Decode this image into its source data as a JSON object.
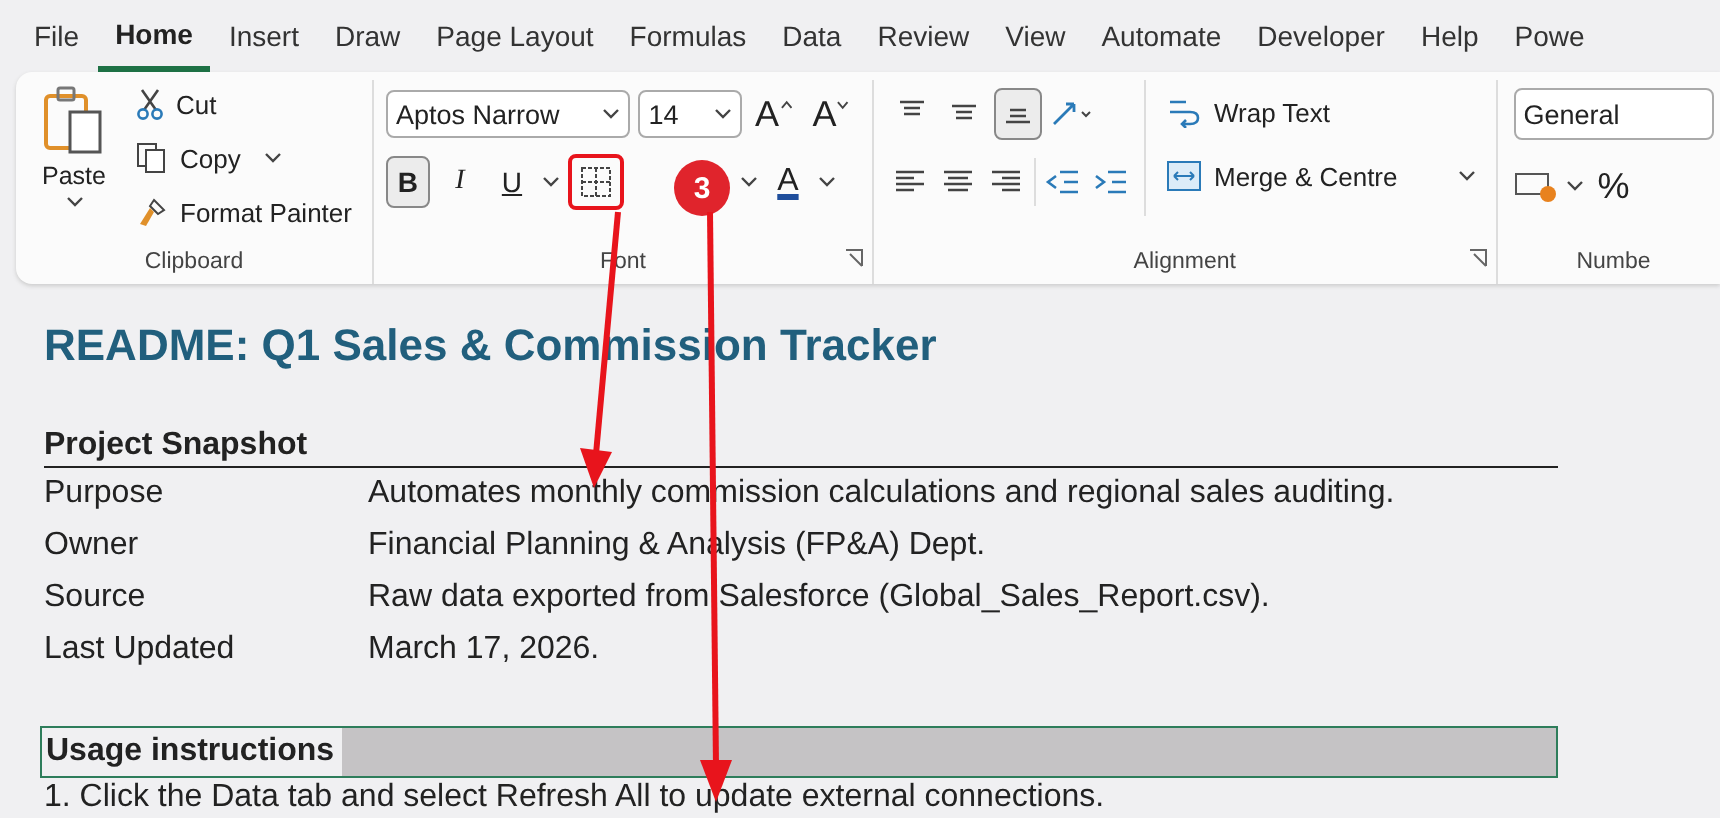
{
  "menu_tabs": [
    {
      "label": "File",
      "selected": false
    },
    {
      "label": "Home",
      "selected": true
    },
    {
      "label": "Insert",
      "selected": false
    },
    {
      "label": "Draw",
      "selected": false
    },
    {
      "label": "Page Layout",
      "selected": false
    },
    {
      "label": "Formulas",
      "selected": false
    },
    {
      "label": "Data",
      "selected": false
    },
    {
      "label": "Review",
      "selected": false
    },
    {
      "label": "View",
      "selected": false
    },
    {
      "label": "Automate",
      "selected": false
    },
    {
      "label": "Developer",
      "selected": false
    },
    {
      "label": "Help",
      "selected": false
    },
    {
      "label": "Powe",
      "selected": false
    }
  ],
  "clipboard": {
    "paste": "Paste",
    "cut": "Cut",
    "copy": "Copy",
    "format_painter": "Format Painter",
    "label": "Clipboard"
  },
  "font": {
    "family": "Aptos Narrow",
    "size": "14",
    "grow": "A",
    "shrink": "A",
    "styles": [
      {
        "label": "B",
        "kind": "bold",
        "selected": true
      },
      {
        "label": "I",
        "kind": "italic",
        "selected": false
      },
      {
        "label": "U",
        "kind": "underline",
        "selected": false
      }
    ],
    "font_color": "A",
    "label": "Font"
  },
  "annotation": {
    "badge": "3"
  },
  "alignment": {
    "vertical": [
      {
        "kind": "top",
        "selected": false
      },
      {
        "kind": "middle",
        "selected": false
      },
      {
        "kind": "bottom",
        "selected": true
      }
    ],
    "wrap_text": "Wrap Text",
    "merge": "Merge & Centre",
    "label": "Alignment"
  },
  "number": {
    "format": "General",
    "percent": "%",
    "label": "Numbe"
  },
  "sheet": {
    "title": "README: Q1 Sales & Commission Tracker",
    "snapshot_heading": "Project Snapshot",
    "rows": [
      {
        "label": "Purpose",
        "value": "Automates monthly commission calculations and regional sales auditing."
      },
      {
        "label": "Owner",
        "value": "Financial Planning & Analysis (FP&A) Dept."
      },
      {
        "label": "Source",
        "value": "Raw data exported from Salesforce (Global_Sales_Report.csv)."
      },
      {
        "label": "Last Updated",
        "value": "March 17, 2026."
      }
    ],
    "usage_heading": "Usage instructions",
    "step": "1. Click the Data tab and select Refresh All to update external connections."
  }
}
